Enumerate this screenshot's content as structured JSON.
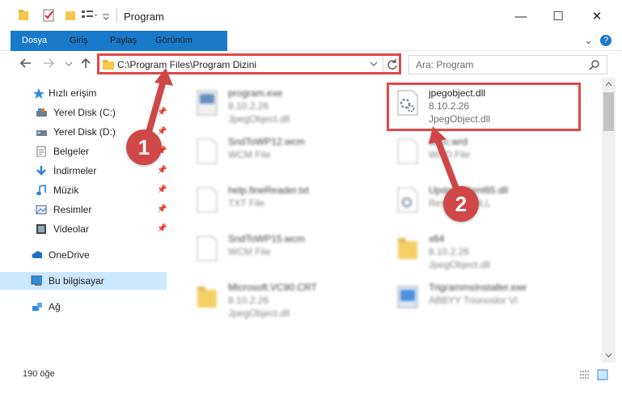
{
  "window": {
    "title": "Program",
    "minimize_glyph": "—",
    "maximize_glyph": "☐",
    "close_glyph": "✕"
  },
  "ribbon": {
    "tabs": [
      "Dosya",
      "Giriş",
      "Paylaş",
      "Görünüm"
    ],
    "collapse_glyph": "⌄",
    "help_glyph": "?"
  },
  "address": {
    "path": "C:\\Program Files\\Program Dizini",
    "search_placeholder": "Ara: Program"
  },
  "nav": {
    "quick_access": "Hızlı erişim",
    "items": [
      {
        "label": "Yerel Disk (C:)",
        "icon": "drive-icon",
        "pinned": true
      },
      {
        "label": "Yerel Disk (D:)",
        "icon": "drive-icon",
        "pinned": true
      },
      {
        "label": "Belgeler",
        "icon": "documents-icon",
        "pinned": true
      },
      {
        "label": "İndirmeler",
        "icon": "download-icon",
        "pinned": true
      },
      {
        "label": "Müzik",
        "icon": "music-icon",
        "pinned": true
      },
      {
        "label": "Resimler",
        "icon": "pictures-icon",
        "pinned": true
      },
      {
        "label": "Videolar",
        "icon": "videos-icon",
        "pinned": true
      }
    ],
    "onedrive": "OneDrive",
    "this_pc": "Bu bilgisayar",
    "network": "Ağ"
  },
  "files": [
    {
      "name": "program.exe",
      "line2": "8.10.2.26",
      "line3": "JpegObject.dll",
      "blurred": true
    },
    {
      "name": "jpegobject.dll",
      "line2": "8.10.2.26",
      "line3": "JpegObject.dll",
      "blurred": false
    },
    {
      "name": "SndToWP12.wcm",
      "line2": "WCM File",
      "line3": "",
      "blurred": true
    },
    {
      "name": "dbcc.wrd",
      "line2": "WRD File",
      "line3": "",
      "blurred": true
    },
    {
      "name": "help.fineReader.txt",
      "line2": "TXT File",
      "line3": "",
      "blurred": true
    },
    {
      "name": "UpdateClient65.dll",
      "line2": "Resource DLL",
      "line3": "",
      "blurred": true
    },
    {
      "name": "SndToWP15.wcm",
      "line2": "WCM File",
      "line3": "",
      "blurred": true
    },
    {
      "name": "x64",
      "line2": "8.10.2.26",
      "line3": "JpegObject.dll",
      "blurred": true
    },
    {
      "name": "Microsoft.VC90.CRT",
      "line2": "8.10.2.26",
      "line3": "JpegObject.dll",
      "blurred": true
    },
    {
      "name": "TrigrammsInstaller.exe",
      "line2": "ABBYY Trionoslor Vi",
      "line3": "",
      "blurred": true
    }
  ],
  "status": {
    "count": "190 öğe"
  },
  "annotations": {
    "badge1": "1",
    "badge2": "2"
  },
  "colors": {
    "accent": "#1979ca",
    "highlight": "#e04848",
    "badge": "#cf4747",
    "selected": "#cce8ff"
  }
}
